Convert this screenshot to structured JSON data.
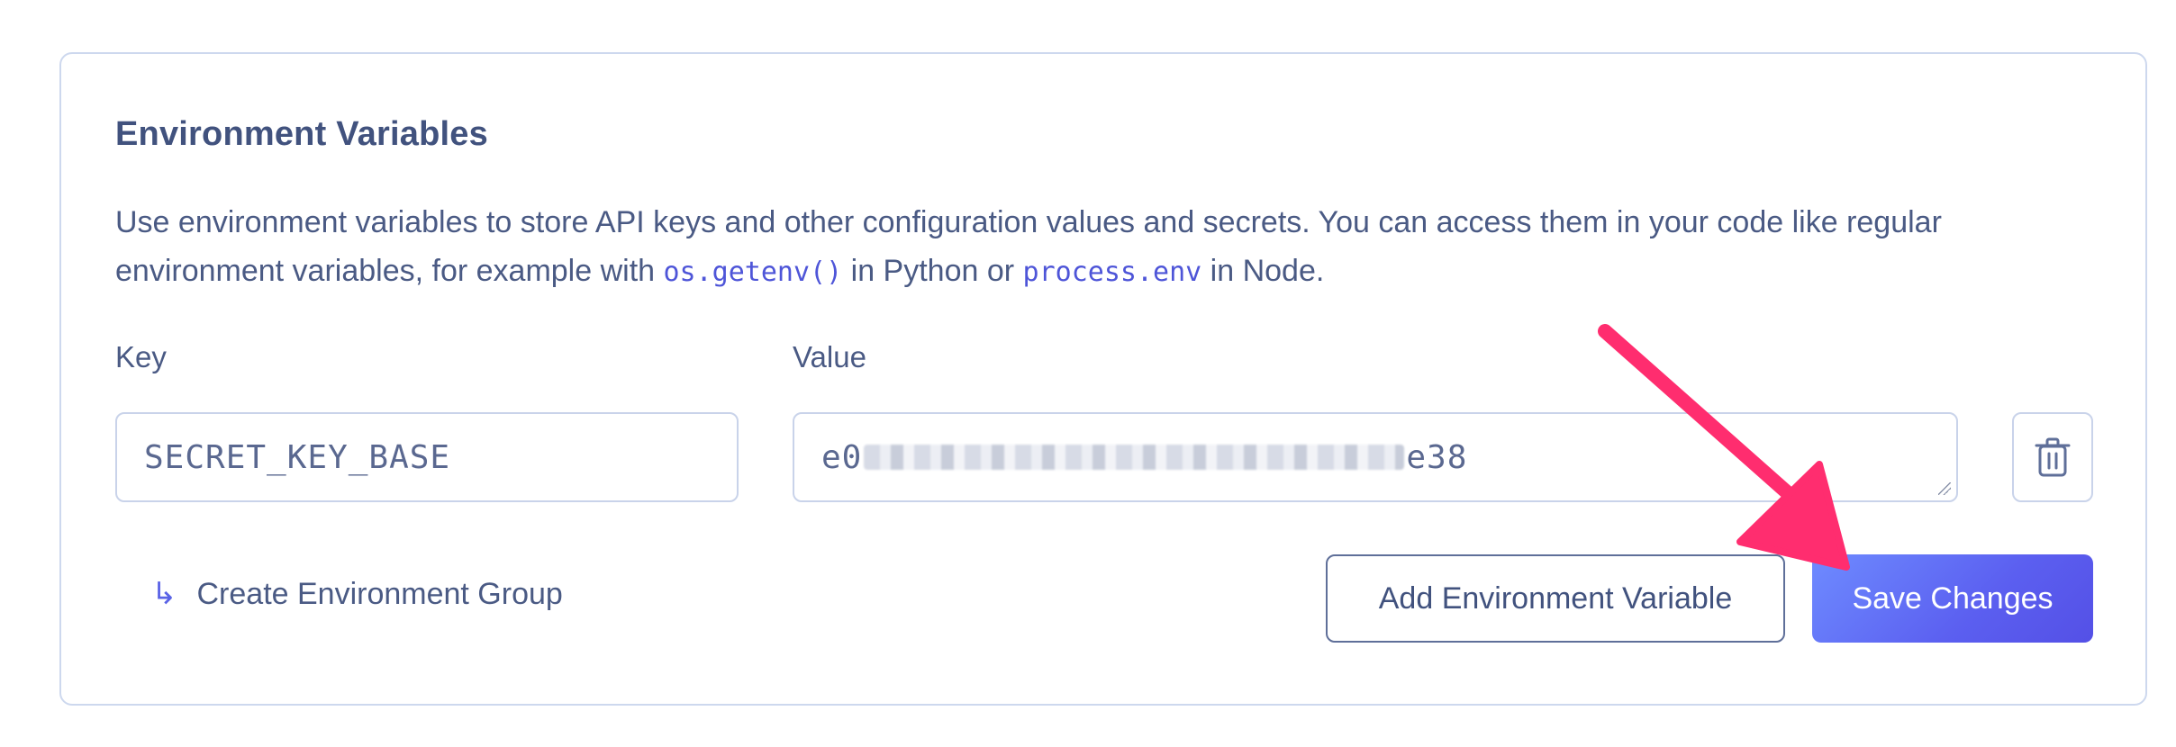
{
  "section": {
    "title": "Environment Variables",
    "description_part1": "Use environment variables to store API keys and other configuration values and secrets. You can access them in your code like regular environment variables, for example with ",
    "code1": "os.getenv()",
    "description_part2": " in Python or ",
    "code2": "process.env",
    "description_part3": " in Node."
  },
  "fields": {
    "key_label": "Key",
    "value_label": "Value",
    "key_value": "SECRET_KEY_BASE",
    "value_prefix": "e0",
    "value_suffix": "e38"
  },
  "actions": {
    "create_group_label": "Create Environment Group",
    "add_variable_label": "Add Environment Variable",
    "save_label": "Save Changes"
  },
  "icons": {
    "delete": "trash-icon",
    "link_arrow": "return-arrow-icon",
    "annotation": "pointer-arrow-icon"
  },
  "colors": {
    "accent": "#5b5ff0",
    "annotation_arrow": "#ff2d6f",
    "border": "#cdd8ee"
  }
}
